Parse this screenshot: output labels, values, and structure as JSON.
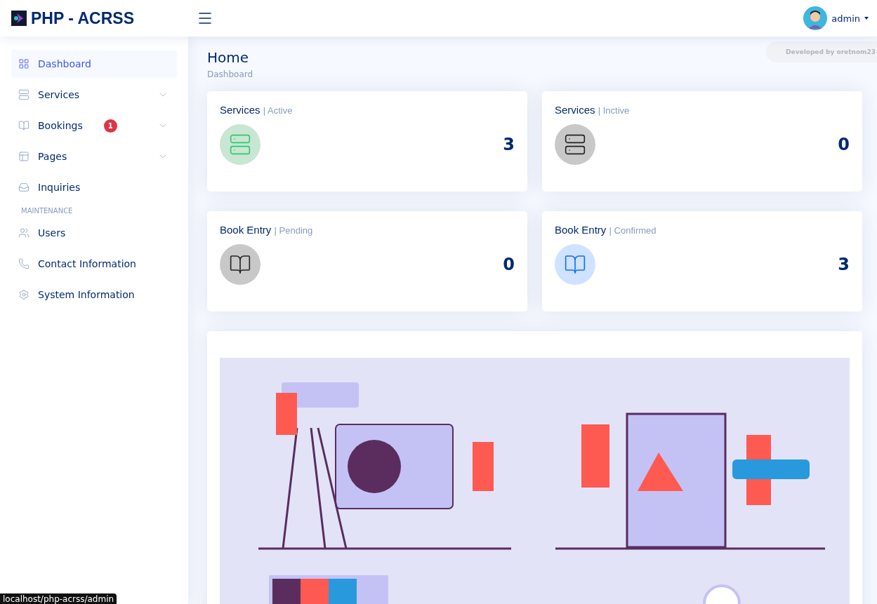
{
  "header": {
    "brand": "PHP - ACRSS",
    "user": "admin"
  },
  "sidebar": {
    "items": [
      {
        "kind": "link",
        "label": "Dashboard",
        "selected": true,
        "has_submenu": false
      },
      {
        "kind": "link",
        "label": "Services",
        "selected": false,
        "has_submenu": true
      },
      {
        "kind": "link",
        "label": "Bookings",
        "selected": false,
        "has_submenu": true,
        "badge": "1"
      },
      {
        "kind": "link",
        "label": "Pages",
        "selected": false,
        "has_submenu": true
      },
      {
        "kind": "link",
        "label": "Inquiries",
        "selected": false,
        "has_submenu": false
      },
      {
        "kind": "heading",
        "label": "MAINTENANCE"
      },
      {
        "kind": "link",
        "label": "Users",
        "selected": false,
        "has_submenu": false
      },
      {
        "kind": "link",
        "label": "Contact Information",
        "selected": false,
        "has_submenu": false
      },
      {
        "kind": "link",
        "label": "System Information",
        "selected": false,
        "has_submenu": false
      }
    ]
  },
  "page": {
    "title": "Home",
    "breadcrumb": "Dashboard",
    "credit": "Developed by oretnom23"
  },
  "cards": [
    {
      "kind": "services",
      "title": "Services",
      "subtitle": "| Active",
      "color": "#c8e6d3",
      "value": "3"
    },
    {
      "kind": "services",
      "title": "Services",
      "subtitle": "| Inctive",
      "color": "#c8c8c8",
      "value": "0"
    },
    {
      "kind": "bookings",
      "title": "Book Entry",
      "subtitle": "| Pending",
      "color": "#c8c8c8",
      "value": "0"
    },
    {
      "kind": "bookings",
      "title": "Book Entry",
      "subtitle": "| Confirmed",
      "color": "#cfe2ff",
      "value": "3"
    }
  ],
  "status_url": "localhost/php-acrss/admin"
}
